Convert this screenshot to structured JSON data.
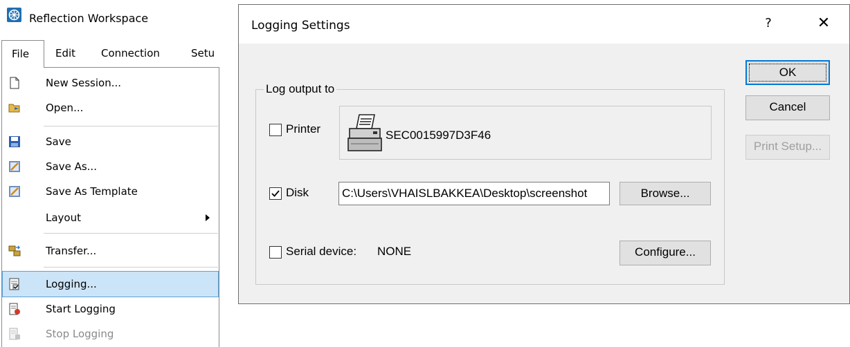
{
  "workspace": {
    "title": "Reflection Workspace",
    "menubar": {
      "file": "File",
      "edit": "Edit",
      "connection": "Connection",
      "setup": "Setu"
    },
    "file_menu": [
      {
        "label": "New Session...",
        "icon": "new-document-icon"
      },
      {
        "label": "Open...",
        "icon": "open-folder-icon"
      },
      {
        "label": "Save",
        "icon": "floppy-disk-icon"
      },
      {
        "label": "Save As...",
        "icon": "save-as-icon"
      },
      {
        "label": "Save As Template",
        "icon": "save-as-template-icon"
      },
      {
        "label": "Layout",
        "icon": ""
      },
      {
        "label": "Transfer...",
        "icon": "transfer-icon"
      },
      {
        "label": "Logging...",
        "icon": "logging-icon"
      },
      {
        "label": "Start Logging",
        "icon": "start-logging-icon"
      },
      {
        "label": "Stop Logging",
        "icon": "stop-logging-icon"
      }
    ]
  },
  "dialog": {
    "title": "Logging Settings",
    "help_glyph": "?",
    "close_glyph": "✕",
    "buttons": {
      "ok": "OK",
      "cancel": "Cancel",
      "print_setup": "Print Setup..."
    },
    "group_label": "Log output to",
    "printer": {
      "label": "Printer",
      "checked": false,
      "name": "SEC0015997D3F46"
    },
    "disk": {
      "label": "Disk",
      "checked": true,
      "path": "C:\\Users\\VHAISLBAKKEA\\Desktop\\screenshot",
      "browse": "Browse..."
    },
    "serial": {
      "label": "Serial device:",
      "value": "NONE",
      "checked": false,
      "configure": "Configure..."
    }
  },
  "colors": {
    "highlight_bg": "#cce4f7",
    "highlight_border": "#5aa2d8",
    "dialog_bg": "#f0f0f0",
    "default_button_border": "#0078d7"
  }
}
